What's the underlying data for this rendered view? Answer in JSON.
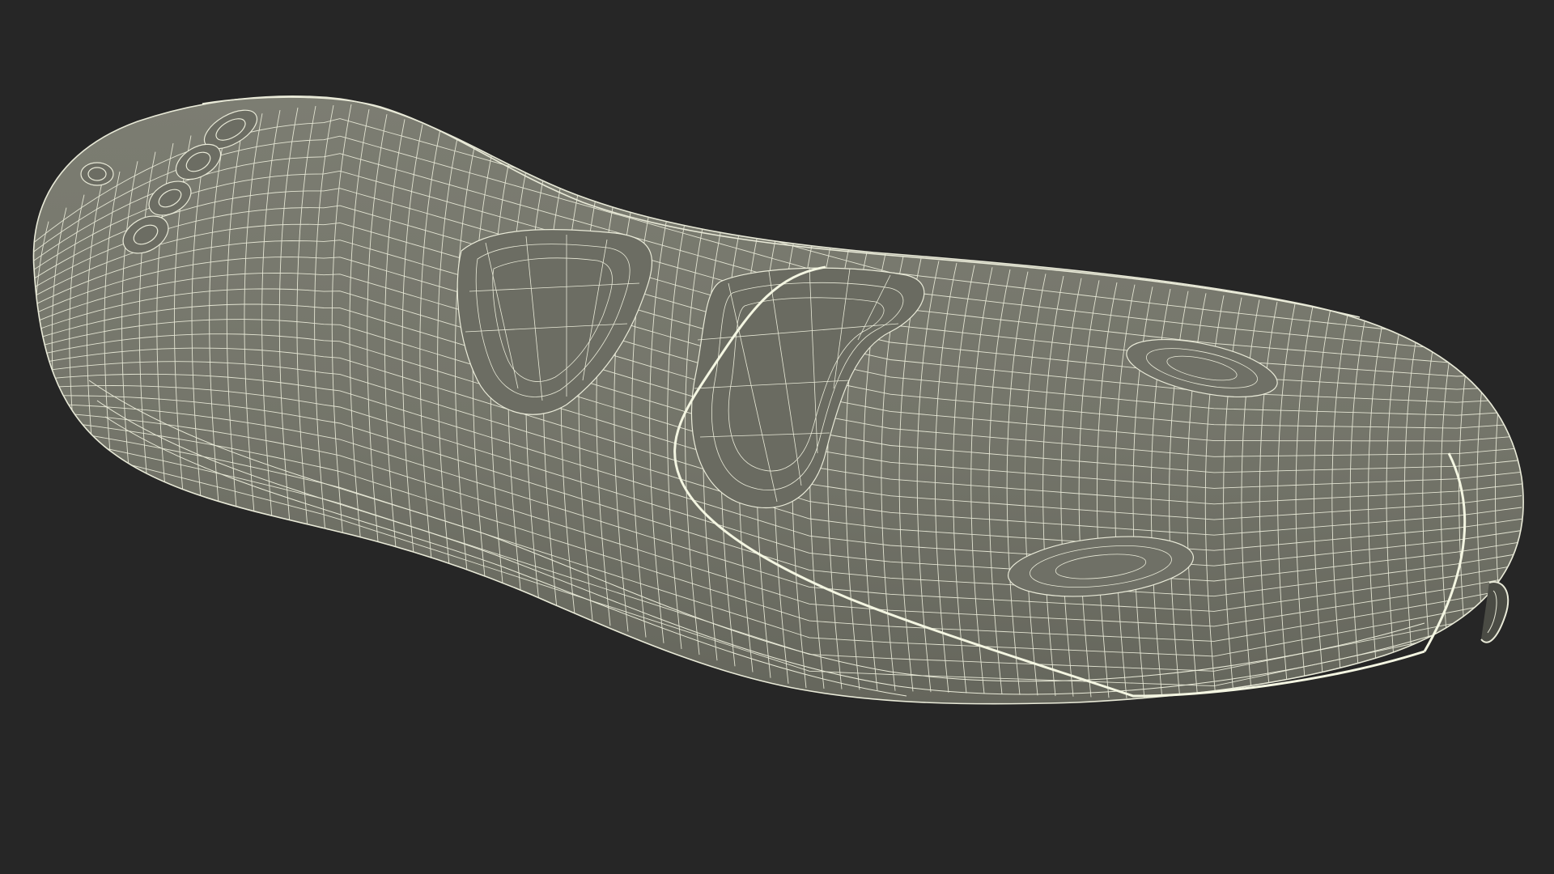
{
  "scene": {
    "background_color": "#262626",
    "surface_color": "#74756a",
    "surface_shade_color": "#5c5d54",
    "wire_color": "#e9ead8",
    "seam_color": "#f4f6e2",
    "object": "wireframe-remote-control-shell"
  }
}
